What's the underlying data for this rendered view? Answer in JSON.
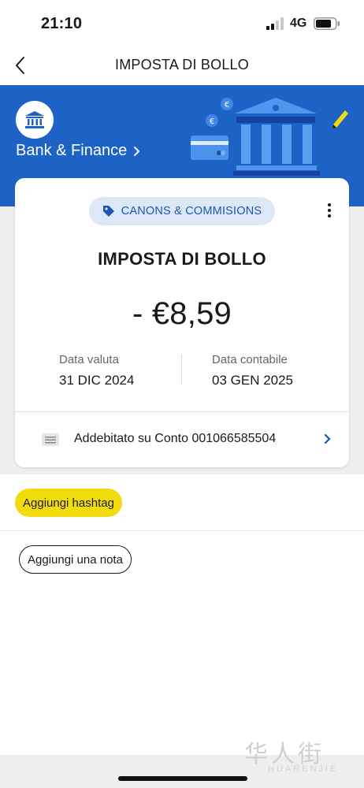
{
  "status_bar": {
    "time": "21:10",
    "network": "4G",
    "signal_bars_filled": 2,
    "signal_bars_total": 4
  },
  "nav": {
    "title": "IMPOSTA DI BOLLO",
    "back_icon": "chevron-left-icon"
  },
  "banner": {
    "category_label": "Bank & Finance",
    "category_icon": "bank-icon",
    "edit_icon": "pencil-icon",
    "background_color": "#1d63c6"
  },
  "transaction": {
    "chip_label": "CANONS & COMMISIONS",
    "chip_icon": "tag-icon",
    "title": "IMPOSTA DI BOLLO",
    "amount": "- €8,59",
    "value_date_label": "Data valuta",
    "value_date": "31 DIC 2024",
    "booking_date_label": "Data contabile",
    "booking_date": "03 GEN 2025",
    "account_text": "Addebitato su Conto 001066585504"
  },
  "actions": {
    "hashtag_label": "Aggiungi hashtag",
    "note_label": "Aggiungi una nota",
    "hashtag_color": "#f3dc0e"
  },
  "watermark": {
    "chinese": "华人街",
    "latin": "HUARENJIE"
  }
}
